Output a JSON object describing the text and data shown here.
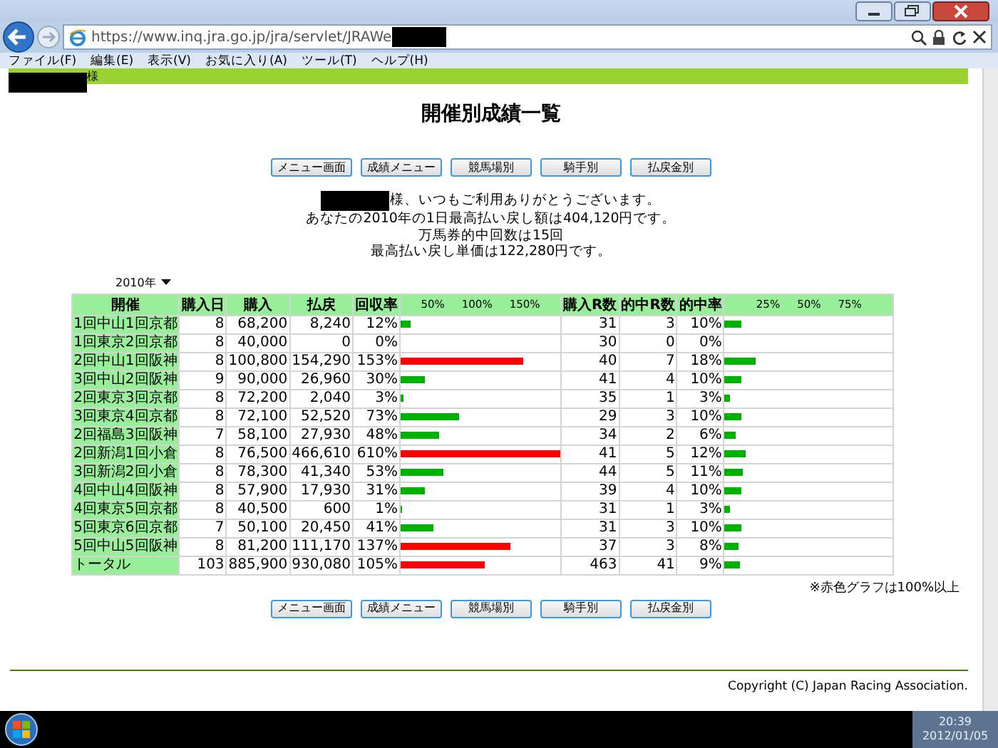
{
  "browser": {
    "address": "https://www.inq.jra.go.jp/jra/servlet/JRAWe",
    "menu": [
      "ファイル(F)",
      "編集(E)",
      "表示(V)",
      "お気に入り(A)",
      "ツール(T)",
      "ヘルプ(H)"
    ]
  },
  "user_bar": {
    "text": "様"
  },
  "page": {
    "title": "開催別成績一覧",
    "nav_top": [
      "メニュー画面",
      "成績メニュー",
      "競馬場別",
      "騎手別",
      "払戻金別"
    ],
    "greeting": "様、いつもご利用ありがとうございます。",
    "message": [
      "あなたの2010年の1日最高払い戻し額は404,120円です。",
      "万馬券的中回数は15回",
      "最高払い戻し単価は122,280円です。"
    ],
    "year_select": "2010年",
    "table": {
      "columns": [
        "開催",
        "購入日",
        "購入",
        "払戻",
        "回収率",
        "購入R数",
        "的中R数",
        "的中率"
      ],
      "rate_scale": [
        "50%",
        "100%",
        "150%"
      ],
      "hit_scale": [
        "25%",
        "50%",
        "75%"
      ],
      "rows": [
        {
          "meeting": "1回中山1回京都",
          "days": "8",
          "purchase": "68,200",
          "payout": "8,240",
          "return_rate": "12%",
          "return_bar": {
            "level": 0.06,
            "color": "#00b000"
          },
          "races": "31",
          "hits": "3",
          "hit_rate": "10%",
          "hit_bar": {
            "level": 0.1
          }
        },
        {
          "meeting": "1回東京2回京都",
          "days": "8",
          "purchase": "40,000",
          "payout": "0",
          "return_rate": "0%",
          "races": "30",
          "hits": "0",
          "hit_rate": "0%"
        },
        {
          "meeting": "2回中山1回阪神",
          "days": "8",
          "purchase": "100,800",
          "payout": "154,290",
          "return_rate": "153%",
          "return_bar": {
            "level": 0.765,
            "color": "#ff0000"
          },
          "races": "40",
          "hits": "7",
          "hit_rate": "18%",
          "hit_bar": {
            "level": 0.18
          }
        },
        {
          "meeting": "3回中山2回阪神",
          "days": "9",
          "purchase": "90,000",
          "payout": "26,960",
          "return_rate": "30%",
          "return_bar": {
            "level": 0.15,
            "color": "#00b000"
          },
          "races": "41",
          "hits": "4",
          "hit_rate": "10%",
          "hit_bar": {
            "level": 0.1
          }
        },
        {
          "meeting": "2回東京3回京都",
          "days": "8",
          "purchase": "72,200",
          "payout": "2,040",
          "return_rate": "3%",
          "return_bar": {
            "level": 0.015,
            "color": "#00b000"
          },
          "races": "35",
          "hits": "1",
          "hit_rate": "3%",
          "hit_bar": {
            "level": 0.03
          }
        },
        {
          "meeting": "3回東京4回京都",
          "days": "8",
          "purchase": "72,100",
          "payout": "52,520",
          "return_rate": "73%",
          "return_bar": {
            "level": 0.365,
            "color": "#00b000"
          },
          "races": "29",
          "hits": "3",
          "hit_rate": "10%",
          "hit_bar": {
            "level": 0.1
          }
        },
        {
          "meeting": "2回福島3回阪神",
          "days": "7",
          "purchase": "58,100",
          "payout": "27,930",
          "return_rate": "48%",
          "return_bar": {
            "level": 0.24,
            "color": "#00b000"
          },
          "races": "34",
          "hits": "2",
          "hit_rate": "6%",
          "hit_bar": {
            "level": 0.06
          }
        },
        {
          "meeting": "2回新潟1回小倉",
          "days": "8",
          "purchase": "76,500",
          "payout": "466,610",
          "return_rate": "610%",
          "return_bar": {
            "level": 1,
            "color": "#ff0000"
          },
          "races": "41",
          "hits": "5",
          "hit_rate": "12%",
          "hit_bar": {
            "level": 0.12
          }
        },
        {
          "meeting": "3回新潟2回小倉",
          "days": "8",
          "purchase": "78,300",
          "payout": "41,340",
          "return_rate": "53%",
          "return_bar": {
            "level": 0.265,
            "color": "#00b000"
          },
          "races": "44",
          "hits": "5",
          "hit_rate": "11%",
          "hit_bar": {
            "level": 0.11
          }
        },
        {
          "meeting": "4回中山4回阪神",
          "days": "8",
          "purchase": "57,900",
          "payout": "17,930",
          "return_rate": "31%",
          "return_bar": {
            "level": 0.155,
            "color": "#00b000"
          },
          "races": "39",
          "hits": "4",
          "hit_rate": "10%",
          "hit_bar": {
            "level": 0.1
          }
        },
        {
          "meeting": "4回東京5回京都",
          "days": "8",
          "purchase": "40,500",
          "payout": "600",
          "return_rate": "1%",
          "return_bar": {
            "level": 0.005,
            "color": "#00b000"
          },
          "races": "31",
          "hits": "1",
          "hit_rate": "3%",
          "hit_bar": {
            "level": 0.03
          }
        },
        {
          "meeting": "5回東京6回京都",
          "days": "7",
          "purchase": "50,100",
          "payout": "20,450",
          "return_rate": "41%",
          "return_bar": {
            "level": 0.205,
            "color": "#00b000"
          },
          "races": "31",
          "hits": "3",
          "hit_rate": "10%",
          "hit_bar": {
            "level": 0.1
          }
        },
        {
          "meeting": "5回中山5回阪神",
          "days": "8",
          "purchase": "81,200",
          "payout": "111,170",
          "return_rate": "137%",
          "return_bar": {
            "level": 0.685,
            "color": "#ff0000"
          },
          "races": "37",
          "hits": "3",
          "hit_rate": "8%",
          "hit_bar": {
            "level": 0.08
          }
        },
        {
          "meeting": "トータル",
          "days": "103",
          "purchase": "885,900",
          "payout": "930,080",
          "return_rate": "105%",
          "return_bar": {
            "level": 0.525,
            "color": "#ff0000"
          },
          "races": "463",
          "hits": "41",
          "hit_rate": "9%",
          "hit_bar": {
            "level": 0.09
          }
        }
      ]
    },
    "note": "※赤色グラフは100%以上",
    "nav_bottom": [
      "メニュー画面",
      "成績メニュー",
      "競馬場別",
      "騎手別",
      "払戻金別"
    ],
    "copyright": "Copyright (C) Japan Racing Association."
  },
  "taskbar": {
    "time": "20:39",
    "date": "2012/01/05"
  }
}
